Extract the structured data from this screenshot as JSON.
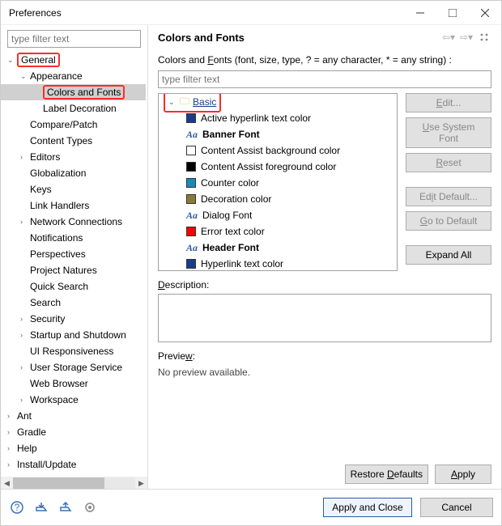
{
  "window": {
    "title": "Preferences"
  },
  "sidebar": {
    "filter_placeholder": "type filter text",
    "items": [
      {
        "label": "General",
        "depth": 0,
        "caret": "v",
        "redbox": true
      },
      {
        "label": "Appearance",
        "depth": 1,
        "caret": "v"
      },
      {
        "label": "Colors and Fonts",
        "depth": 2,
        "selected": true,
        "redbox": true
      },
      {
        "label": "Label Decoration",
        "depth": 2
      },
      {
        "label": "Compare/Patch",
        "depth": 1
      },
      {
        "label": "Content Types",
        "depth": 1
      },
      {
        "label": "Editors",
        "depth": 1,
        "caret": ">"
      },
      {
        "label": "Globalization",
        "depth": 1
      },
      {
        "label": "Keys",
        "depth": 1
      },
      {
        "label": "Link Handlers",
        "depth": 1
      },
      {
        "label": "Network Connections",
        "depth": 1,
        "caret": ">"
      },
      {
        "label": "Notifications",
        "depth": 1
      },
      {
        "label": "Perspectives",
        "depth": 1
      },
      {
        "label": "Project Natures",
        "depth": 1
      },
      {
        "label": "Quick Search",
        "depth": 1
      },
      {
        "label": "Search",
        "depth": 1
      },
      {
        "label": "Security",
        "depth": 1,
        "caret": ">"
      },
      {
        "label": "Startup and Shutdown",
        "depth": 1,
        "caret": ">"
      },
      {
        "label": "UI Responsiveness",
        "depth": 1
      },
      {
        "label": "User Storage Service",
        "depth": 1,
        "caret": ">"
      },
      {
        "label": "Web Browser",
        "depth": 1
      },
      {
        "label": "Workspace",
        "depth": 1,
        "caret": ">"
      },
      {
        "label": "Ant",
        "depth": 0,
        "caret": ">"
      },
      {
        "label": "Gradle",
        "depth": 0,
        "caret": ">"
      },
      {
        "label": "Help",
        "depth": 0,
        "caret": ">"
      },
      {
        "label": "Install/Update",
        "depth": 0,
        "caret": ">"
      }
    ]
  },
  "content": {
    "heading": "Colors and Fonts",
    "description_prefix": "Colors and ",
    "description_underline": "F",
    "description_suffix": "onts (font, size, type, ? = any character, * = any string) :",
    "filter_placeholder": "type filter text",
    "tree_root": {
      "label": "Basic",
      "expanded": true,
      "redbox": true
    },
    "items": [
      {
        "label": "Active hyperlink text color",
        "swatch": "#1a3c8c",
        "type": "color"
      },
      {
        "label": "Banner Font",
        "type": "font",
        "bold": true
      },
      {
        "label": "Content Assist background color",
        "swatch": "#ffffff",
        "type": "color"
      },
      {
        "label": "Content Assist foreground color",
        "swatch": "#000000",
        "type": "color"
      },
      {
        "label": "Counter color",
        "swatch": "#1a8ab5",
        "type": "color"
      },
      {
        "label": "Decoration color",
        "swatch": "#8a7a3a",
        "type": "color"
      },
      {
        "label": "Dialog Font",
        "type": "font"
      },
      {
        "label": "Error text color",
        "swatch": "#ff0000",
        "type": "color"
      },
      {
        "label": "Header Font",
        "type": "font",
        "bold": true
      },
      {
        "label": "Hyperlink text color",
        "swatch": "#1a3c8c",
        "type": "color"
      }
    ],
    "buttons": {
      "edit": "Edit...",
      "use_system": "Use System Font",
      "reset": "Reset",
      "edit_default": "Edit Default...",
      "go_default": "Go to Default",
      "expand_all": "Expand All"
    },
    "description_label": "Description:",
    "preview_label": "Preview:",
    "preview_text": "No preview available.",
    "restore_defaults": "Restore Defaults",
    "apply": "Apply"
  },
  "footer": {
    "apply_close": "Apply and Close",
    "cancel": "Cancel"
  }
}
